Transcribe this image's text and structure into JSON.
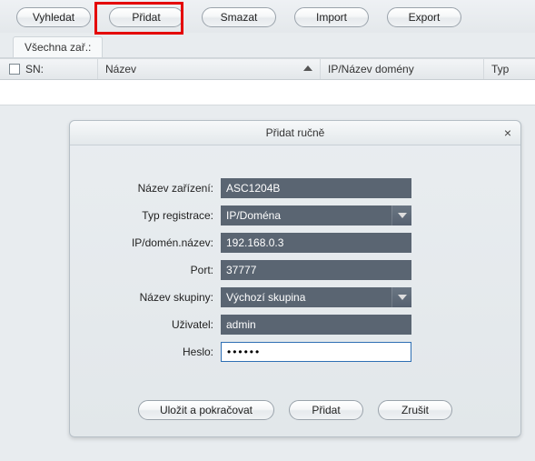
{
  "toolbar": {
    "search": "Vyhledat",
    "add": "Přidat",
    "delete": "Smazat",
    "import": "Import",
    "export": "Export"
  },
  "tab": {
    "all_devices": "Všechna zař.:"
  },
  "grid": {
    "sn": "SN:",
    "name": "Název",
    "ip": "IP/Název domény",
    "type": "Typ"
  },
  "dialog": {
    "title": "Přidat ručně",
    "labels": {
      "device_name": "Název zařízení:",
      "reg_type": "Typ registrace:",
      "ip_domain": "IP/domén.název:",
      "port": "Port:",
      "group": "Název skupiny:",
      "user": "Uživatel:",
      "password": "Heslo:"
    },
    "values": {
      "device_name": "ASC1204B",
      "reg_type": "IP/Doména",
      "ip_domain": "192.168.0.3",
      "port": "37777",
      "group": "Výchozí skupina",
      "user": "admin",
      "password": "••••••"
    },
    "buttons": {
      "save_continue": "Uložit a pokračovat",
      "add": "Přidat",
      "cancel": "Zrušit"
    }
  }
}
